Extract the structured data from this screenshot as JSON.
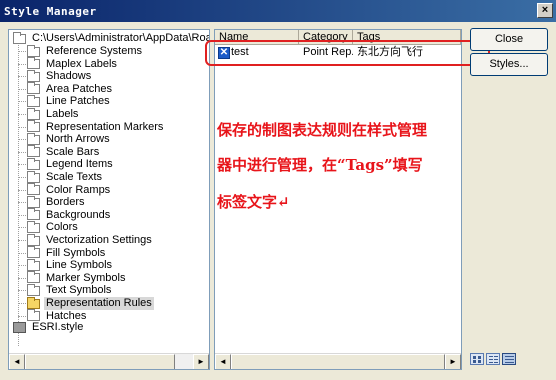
{
  "window": {
    "title": "Style Manager",
    "close_glyph": "×"
  },
  "tree": {
    "root": "C:\\Users\\Administrator\\AppData\\Roaming\\",
    "items": [
      "Reference Systems",
      "Maplex Labels",
      "Shadows",
      "Area Patches",
      "Line Patches",
      "Labels",
      "Representation Markers",
      "North Arrows",
      "Scale Bars",
      "Legend Items",
      "Scale Texts",
      "Color Ramps",
      "Borders",
      "Backgrounds",
      "Colors",
      "Vectorization Settings",
      "Fill Symbols",
      "Line Symbols",
      "Marker Symbols",
      "Text Symbols",
      "Representation Rules",
      "Hatches"
    ],
    "selected_index": 20,
    "second_root": "ESRI.style"
  },
  "list": {
    "columns": [
      "Name",
      "Category",
      "Tags"
    ],
    "rows": [
      {
        "name": "test",
        "category": "Point Rep...",
        "tags": "东北方向飞行",
        "icon": "representation-rule-icon"
      }
    ]
  },
  "annotation": {
    "lines": [
      "保存的制图表达规则在样式管理",
      "器中进行管理，在“Tags”填写",
      "标签文字↵"
    ],
    "color": "#e8141a"
  },
  "buttons": {
    "close": "Close",
    "styles": "Styles..."
  },
  "scrollbar": {
    "left_arrow": "◄",
    "right_arrow": "►"
  },
  "view_modes": [
    "large-icons-view-icon",
    "list-view-icon",
    "details-view-icon"
  ]
}
